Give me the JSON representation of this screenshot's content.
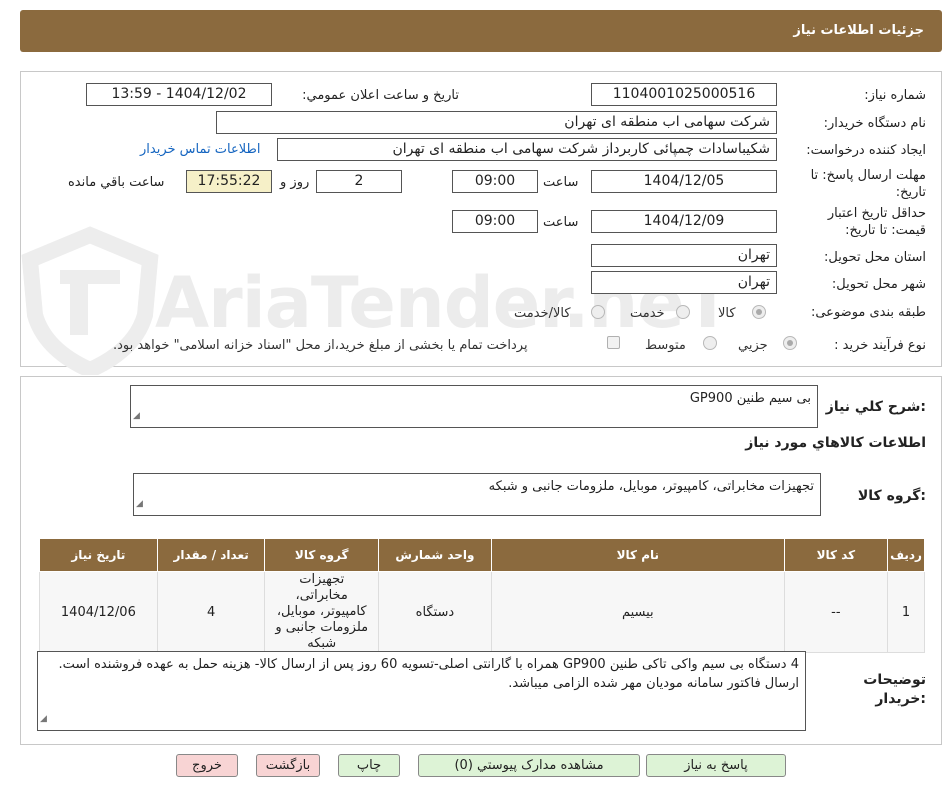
{
  "header": {
    "title": "جزئیات اطلاعات نیاز"
  },
  "watermark": {
    "text": "AriaTender.neT",
    "color": "#ececec"
  },
  "form": {
    "need_number_label": "شماره نیاز:",
    "need_number": "1104001025000516",
    "announce_label": "تاریخ و ساعت اعلان عمومي:",
    "announce_value": "1404/12/02 - 13:59",
    "buyer_label": "نام دستگاه خريدار:",
    "buyer_value": "شرکت سهامی اب منطقه ای تهران",
    "creator_label": "ايجاد کننده درخواست:",
    "creator_value": "شکیباسادات چمپائی کاربرداز شرکت سهامی اب منطقه ای تهران",
    "contact_link": "اطلاعات تماس خريدار",
    "deadline_label_1": "مهلت ارسال پاسخ: تا",
    "deadline_label_2": "تاریخ:",
    "deadline_date": "1404/12/05",
    "time_label": "ساعت",
    "deadline_time": "09:00",
    "days_value": "2",
    "days_label": "روز و",
    "remaining_time": "17:55:22",
    "remaining_label": "ساعت باقي مانده",
    "validity_label_1": "حداقل تاريخ اعتبار",
    "validity_label_2": "قیمت: تا تاریخ:",
    "validity_date": "1404/12/09",
    "validity_time": "09:00",
    "province_label": "استان محل تحويل:",
    "province_value": "تهران",
    "city_label": "شهر محل تحويل:",
    "city_value": "تهران",
    "category_label": "طبقه بندی موضوعی:",
    "category_options": [
      "کالا",
      "خدمت",
      "کالا/خدمت"
    ],
    "process_label": "نوع فرآيند خريد :",
    "process_options": [
      "جزيي",
      "متوسط"
    ],
    "payment_note": "پرداخت تمام يا بخشی از مبلغ خريد،از محل \"اسناد خزانه اسلامی\" خواهد بود."
  },
  "details": {
    "summary_label": "شرح کلي نياز:",
    "summary_value": "بی سیم طنین GP900",
    "goods_section_title": "اطلاعات کالاهاي مورد نياز",
    "group_label": "گروه کالا:",
    "group_value": "تجهیزات مخابراتی، کامپیوتر، موبایل، ملزومات جانبی و شبکه",
    "table": {
      "headers": [
        "رديف",
        "کد کالا",
        "نام کالا",
        "واحد شمارش",
        "گروه کالا",
        "تعداد / مقدار",
        "تاريخ نياز"
      ],
      "rows": [
        {
          "index": "1",
          "code": "--",
          "name": "بیسیم",
          "unit": "دستگاه",
          "group": "تجهیزات مخابراتی، کامپیوتر، موبایل، ملزومات جانبی و شبکه",
          "qty": "4",
          "date": "1404/12/06"
        }
      ]
    },
    "buyer_notes_label_1": "توضيحات",
    "buyer_notes_label_2": "خريدار:",
    "buyer_notes_value": "4 دستگاه بی سیم واکی تاکی  طنین GP900 همراه با گارانتی اصلی-تسویه 60 روز پس از ارسال کالا-  هزینه حمل به عهده فروشنده است. ارسال فاکتور سامانه مودیان مهر شده الزامی میباشد."
  },
  "buttons": {
    "reply": "پاسخ به نياز",
    "attachments": "مشاهده مدارک پيوستي (0)",
    "print": "چاپ",
    "back": "بازگشت",
    "exit": "خروج"
  }
}
